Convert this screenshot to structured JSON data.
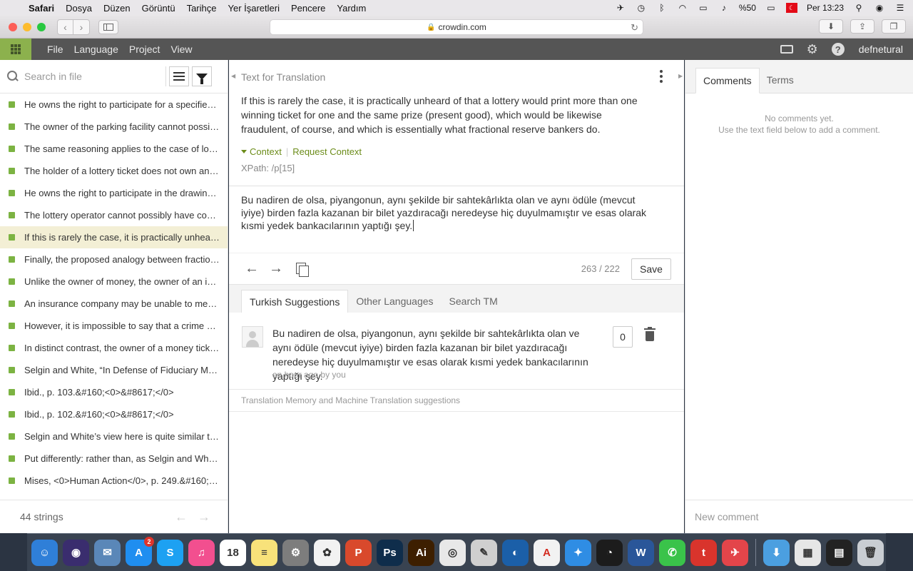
{
  "menubar": {
    "apple": "",
    "items": [
      "Safari",
      "Dosya",
      "Düzen",
      "Görüntü",
      "Tarihçe",
      "Yer İşaretleri",
      "Pencere",
      "Yardım"
    ],
    "battery": "%50",
    "clock": "Per 13:23"
  },
  "browser": {
    "url": "crowdin.com"
  },
  "appbar": {
    "menus": [
      "File",
      "Language",
      "Project",
      "View"
    ],
    "username": "defnetural"
  },
  "left_panel": {
    "search_placeholder": "Search in file",
    "strings": [
      {
        "text": "He owns the right to participate for a specified pe...",
        "active": false
      },
      {
        "text": "The owner of the parking facility cannot possibly ...",
        "active": false
      },
      {
        "text": "The same reasoning applies to the case of lotteri...",
        "active": false
      },
      {
        "text": "The holder of a lottery ticket does not own any pr...",
        "active": false
      },
      {
        "text": "He owns the right to participate in the drawing of...",
        "active": false
      },
      {
        "text": "The lottery operator cannot possibly have commi...",
        "active": false
      },
      {
        "text": "If this is rarely the case, it is practically unheard o...",
        "active": true
      },
      {
        "text": "Finally, the proposed analogy between fractional ...",
        "active": false
      },
      {
        "text": "Unlike the owner of money, the owner of an insu...",
        "active": false
      },
      {
        "text": "An insurance company may be unable to meet its...",
        "active": false
      },
      {
        "text": "However, it is impossible to say that a crime has ...",
        "active": false
      },
      {
        "text": "In distinct contrast, the owner of a money ticket i...",
        "active": false
      },
      {
        "text": "Selgin and White, “In Defense of Fiduciary Media,”...",
        "active": false
      },
      {
        "text": "Ibid., p. 103.&#160;<0>&#8617;</0>",
        "active": false
      },
      {
        "text": "Ibid., p. 102.&#160;<0>&#8617;</0>",
        "active": false
      },
      {
        "text": "Selgin and White’s view here is quite similar to th...",
        "active": false
      },
      {
        "text": "Put differently: rather than, as Selgin and White (“...",
        "active": false
      },
      {
        "text": "Mises, <0>Human Action</0>, p. 249.&#160;<1>&...",
        "active": false
      }
    ],
    "count_label": "44 strings"
  },
  "center_panel": {
    "header": "Text for Translation",
    "source_text": "If this is rarely the case, it is practically unheard of that a lottery would print more than one winning ticket for one and the same prize (present good), which would be likewise fraudulent, of course, and which is essentially what fractional reserve bankers do.",
    "context_label": "Context",
    "request_context_label": "Request Context",
    "xpath": "XPath: /p[15]",
    "translation_text": "Bu nadiren de olsa, piyangonun, aynı şekilde bir sahtekârlıkta olan ve aynı ödüle (mevcut iyiye) birden fazla kazanan bir bilet yazdıracağı neredeyse hiç duyulmamıştır ve esas olarak kısmi yedek bankacılarının yaptığı şey.",
    "char_count": "263 / 222",
    "save_label": "Save",
    "suggestion_tabs": [
      {
        "label": "Turkish Suggestions",
        "active": true
      },
      {
        "label": "Other Languages",
        "active": false
      },
      {
        "label": "Search TM",
        "active": false
      }
    ],
    "suggestion": {
      "text": "Bu nadiren de olsa, piyangonun, aynı şekilde bir sahtekârlıkta olan ve aynı ödüle (mevcut iyiye) birden fazla kazanan bir bilet yazdıracağı neredeyse hiç duyulmamıştır ve esas olarak kısmi yedek bankacılarının yaptığı şey.",
      "meta": "an hour ago by you",
      "votes": "0"
    },
    "tm_note": "Translation Memory and Machine Translation suggestions"
  },
  "right_panel": {
    "tabs": [
      {
        "label": "Comments",
        "active": true
      },
      {
        "label": "Terms",
        "active": false
      }
    ],
    "empty_line1": "No comments yet.",
    "empty_line2": "Use the text field below to add a comment.",
    "new_comment_placeholder": "New comment"
  },
  "dock": {
    "apps": [
      {
        "name": "finder",
        "color": "#2f7fd8",
        "glyph": "☺"
      },
      {
        "name": "siri",
        "color": "#3a2d6e",
        "glyph": "◉"
      },
      {
        "name": "preview",
        "color": "#5a87b8",
        "glyph": "✉"
      },
      {
        "name": "app-store",
        "color": "#1f8ef0",
        "glyph": "A",
        "badge": "2"
      },
      {
        "name": "skype",
        "color": "#1da1f2",
        "glyph": "S"
      },
      {
        "name": "itunes",
        "color": "#f24f8f",
        "glyph": "♫"
      },
      {
        "name": "calendar",
        "color": "#ffffff",
        "glyph": "18",
        "dark": true
      },
      {
        "name": "notes",
        "color": "#f8e27a",
        "glyph": "≡",
        "dark": true
      },
      {
        "name": "system-preferences",
        "color": "#7d7d7d",
        "glyph": "⚙"
      },
      {
        "name": "photos",
        "color": "#f2f2f2",
        "glyph": "✿",
        "dark": true
      },
      {
        "name": "wps",
        "color": "#d9492c",
        "glyph": "P"
      },
      {
        "name": "photoshop",
        "color": "#0f2d4b",
        "glyph": "Ps"
      },
      {
        "name": "illustrator",
        "color": "#3d1f00",
        "glyph": "Ai"
      },
      {
        "name": "chrome",
        "color": "#e8e8e8",
        "glyph": "◎",
        "dark": true
      },
      {
        "name": "script-editor",
        "color": "#cfcfcf",
        "glyph": "✎",
        "dark": true
      },
      {
        "name": "camera-raw",
        "color": "#1b5fa8",
        "glyph": "◐"
      },
      {
        "name": "acrobat",
        "color": "#f2f2f2",
        "glyph": "A",
        "red": true
      },
      {
        "name": "safari",
        "color": "#2f8de4",
        "glyph": "✦"
      },
      {
        "name": "spotify",
        "color": "#1c1c1c",
        "glyph": "◔"
      },
      {
        "name": "word",
        "color": "#2a5699",
        "glyph": "W"
      },
      {
        "name": "messages",
        "color": "#3ac34a",
        "glyph": "✆"
      },
      {
        "name": "tumblr",
        "color": "#d9342c",
        "glyph": "t"
      },
      {
        "name": "airmail",
        "color": "#e3454a",
        "glyph": "✈"
      }
    ],
    "right_apps": [
      {
        "name": "downloads",
        "color": "#4b9fe0",
        "glyph": "⬇"
      },
      {
        "name": "window-thumb",
        "color": "#e6e6e6",
        "glyph": "▦",
        "dark": true
      },
      {
        "name": "terminal-thumb",
        "color": "#222222",
        "glyph": "▤"
      },
      {
        "name": "trash",
        "color": "#c9cdd2",
        "glyph": "🗑",
        "dark": true
      }
    ]
  }
}
